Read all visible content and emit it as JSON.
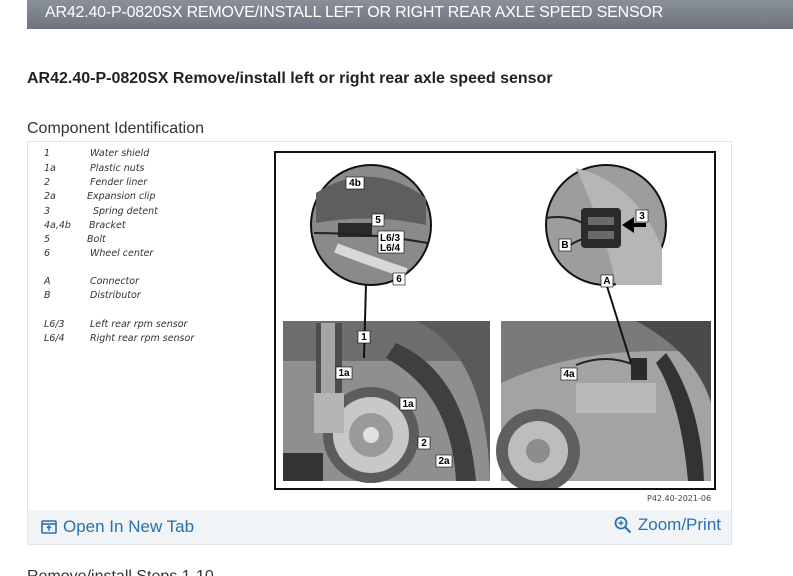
{
  "header": {
    "title": "AR42.40-P-0820SX REMOVE/INSTALL LEFT OR RIGHT REAR AXLE SPEED SENSOR"
  },
  "document": {
    "title": "AR42.40-P-0820SX Remove/install left or right rear axle speed sensor",
    "section_label": "Component Identification",
    "next_step_label": "Remove/install Steps 1-10"
  },
  "figure": {
    "legend": [
      {
        "key": "1",
        "label": "Water shield"
      },
      {
        "key": "1a",
        "label": "Plastic nuts"
      },
      {
        "key": "2",
        "label": "Fender liner"
      },
      {
        "key": "2a",
        "label": "Expansion clip"
      },
      {
        "key": "3",
        "label": "Spring detent"
      },
      {
        "key": "4a,4b",
        "label": "Bracket"
      },
      {
        "key": "5",
        "label": "Bolt"
      },
      {
        "key": "6",
        "label": "Wheel center"
      },
      {
        "key": "A",
        "label": "Connector"
      },
      {
        "key": "B",
        "label": "Distributor"
      },
      {
        "key": "L6/3",
        "label": "Left rear rpm sensor"
      },
      {
        "key": "L6/4",
        "label": "Right rear rpm sensor"
      }
    ],
    "callouts": {
      "c4b": "4b",
      "c5": "5",
      "cL63": "L6/3",
      "cL64": "L6/4",
      "c6": "6",
      "c3": "3",
      "cB": "B",
      "cA": "A",
      "c1": "1",
      "c1a_left": "1a",
      "c1a_right": "1a",
      "c2": "2",
      "c2a": "2a",
      "c4a": "4a"
    },
    "reference": "P42.40-2021-06"
  },
  "actions": {
    "open_new_tab": "Open In New Tab",
    "zoom_print": "Zoom/Print"
  },
  "colors": {
    "header_bg": "#7b818a",
    "link": "#2a6fb0",
    "card_bg": "#f1f4f7"
  }
}
